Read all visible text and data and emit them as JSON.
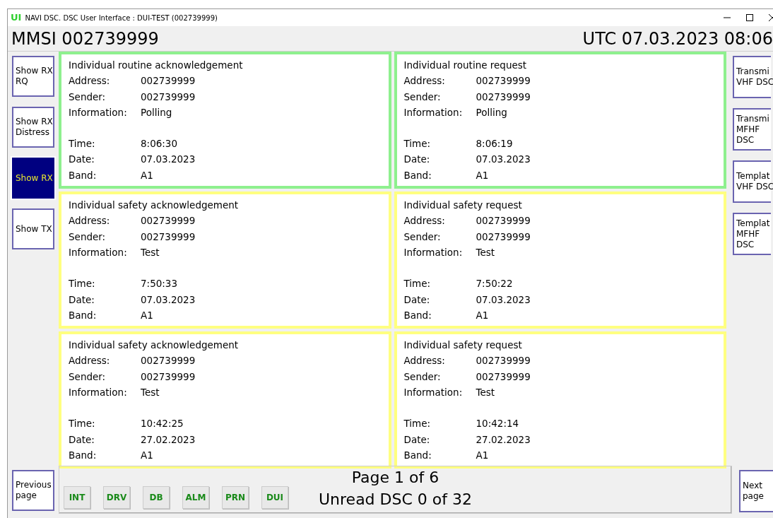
{
  "window": {
    "title": "NAVI DSC. DSC User Interface : DUI-TEST (002739999)",
    "logo": "UI"
  },
  "header": {
    "mmsi": "MMSI 002739999",
    "utc": "UTC 07.03.2023 08:06"
  },
  "left_buttons": [
    {
      "lines": [
        "Show RX",
        "RQ"
      ],
      "selected": false
    },
    {
      "lines": [
        "Show RX",
        "Distress"
      ],
      "selected": false
    },
    {
      "lines": [
        "Show RX"
      ],
      "selected": true
    },
    {
      "lines": [
        "Show TX"
      ],
      "selected": false
    }
  ],
  "right_buttons": [
    {
      "lines": [
        "Transmi",
        "VHF DSC"
      ]
    },
    {
      "lines": [
        "Transmi",
        "MFHF",
        "DSC"
      ]
    },
    {
      "lines": [
        "Templat",
        "VHF DSC"
      ]
    },
    {
      "lines": [
        "Templat",
        "MFHF",
        "DSC"
      ]
    }
  ],
  "messages": [
    {
      "title": "Individual routine acknowledgement",
      "color": "#8ef08e",
      "details": [
        {
          "label": "Address:",
          "value": "002739999"
        },
        {
          "label": "Sender:",
          "value": "002739999"
        },
        {
          "label": "Information:",
          "value": "Polling"
        }
      ],
      "timing": [
        {
          "label": "Time:",
          "value": "8:06:30"
        },
        {
          "label": "Date:",
          "value": "07.03.2023"
        },
        {
          "label": "Band:",
          "value": "A1"
        }
      ]
    },
    {
      "title": "Individual routine request",
      "color": "#8ef08e",
      "details": [
        {
          "label": "Address:",
          "value": "002739999"
        },
        {
          "label": "Sender:",
          "value": "002739999"
        },
        {
          "label": "Information:",
          "value": "Polling"
        }
      ],
      "timing": [
        {
          "label": "Time:",
          "value": "8:06:19"
        },
        {
          "label": "Date:",
          "value": "07.03.2023"
        },
        {
          "label": "Band:",
          "value": "A1"
        }
      ]
    },
    {
      "title": "Individual safety acknowledgement",
      "color": "#ffff80",
      "details": [
        {
          "label": "Address:",
          "value": "002739999"
        },
        {
          "label": "Sender:",
          "value": "002739999"
        },
        {
          "label": "Information:",
          "value": "Test"
        }
      ],
      "timing": [
        {
          "label": "Time:",
          "value": "7:50:33"
        },
        {
          "label": "Date:",
          "value": "07.03.2023"
        },
        {
          "label": "Band:",
          "value": "A1"
        }
      ]
    },
    {
      "title": "Individual safety request",
      "color": "#ffff80",
      "details": [
        {
          "label": "Address:",
          "value": "002739999"
        },
        {
          "label": "Sender:",
          "value": "002739999"
        },
        {
          "label": "Information:",
          "value": "Test"
        }
      ],
      "timing": [
        {
          "label": "Time:",
          "value": "7:50:22"
        },
        {
          "label": "Date:",
          "value": "07.03.2023"
        },
        {
          "label": "Band:",
          "value": "A1"
        }
      ]
    },
    {
      "title": "Individual safety acknowledgement",
      "color": "#ffff80",
      "details": [
        {
          "label": "Address:",
          "value": "002739999"
        },
        {
          "label": "Sender:",
          "value": "002739999"
        },
        {
          "label": "Information:",
          "value": "Test"
        }
      ],
      "timing": [
        {
          "label": "Time:",
          "value": "10:42:25"
        },
        {
          "label": "Date:",
          "value": "27.02.2023"
        },
        {
          "label": "Band:",
          "value": "A1"
        }
      ]
    },
    {
      "title": "Individual safety request",
      "color": "#ffff80",
      "details": [
        {
          "label": "Address:",
          "value": "002739999"
        },
        {
          "label": "Sender:",
          "value": "002739999"
        },
        {
          "label": "Information:",
          "value": "Test"
        }
      ],
      "timing": [
        {
          "label": "Time:",
          "value": "10:42:14"
        },
        {
          "label": "Date:",
          "value": "27.02.2023"
        },
        {
          "label": "Band:",
          "value": "A1"
        }
      ]
    }
  ],
  "footer": {
    "previous": [
      "Previous",
      "page"
    ],
    "next": [
      "Next",
      "page"
    ],
    "modules": [
      "INT",
      "DRV",
      "DB",
      "ALM",
      "PRN",
      "DUI"
    ],
    "page": "Page 1 of 6",
    "unread": "Unread DSC 0 of 32"
  }
}
